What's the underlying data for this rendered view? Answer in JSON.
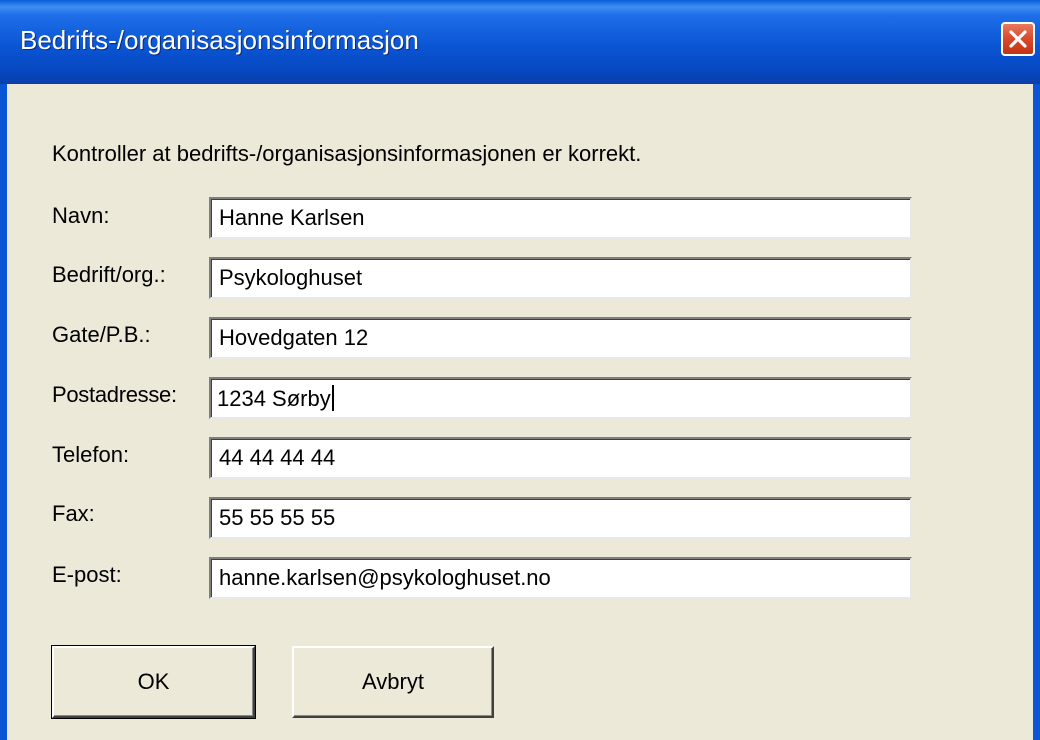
{
  "window": {
    "title": "Bedrifts-/organisasjonsinformasjon"
  },
  "instruction": "Kontroller at bedrifts-/organisasjonsinformasjonen er korrekt.",
  "fields": [
    {
      "label": "Navn:",
      "value": "Hanne Karlsen"
    },
    {
      "label": "Bedrift/org.:",
      "value": "Psykologhuset"
    },
    {
      "label": "Gate/P.B.:",
      "value": "Hovedgaten 12"
    },
    {
      "label": "Postadresse:",
      "value": "1234 Sørby"
    },
    {
      "label": "Telefon:",
      "value": "44 44 44 44"
    },
    {
      "label": "Fax:",
      "value": "55 55 55 55"
    },
    {
      "label": "E-post:",
      "value": "hanne.karlsen@psykologhuset.no"
    }
  ],
  "buttons": {
    "ok": "OK",
    "cancel": "Avbryt"
  },
  "colors": {
    "titlebar": "#0a55d4",
    "dialog_background": "#ece9d8",
    "close_button": "#d9482c"
  },
  "icons": {
    "close": "close-icon"
  }
}
